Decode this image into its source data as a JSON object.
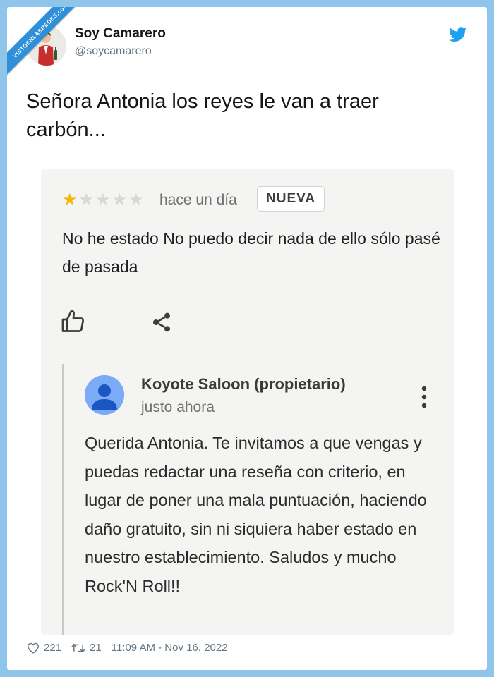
{
  "watermark": "VISTOENLASREDES.com",
  "user": {
    "name": "Soy Camarero",
    "handle": "@soycamarero"
  },
  "tweet": {
    "text": "Señora Antonia los reyes le van a traer carbón..."
  },
  "review": {
    "stars_filled": 1,
    "stars_total": 5,
    "time_ago": "hace un día",
    "badge": "NUEVA",
    "text": "No he estado No puedo decir nada de ello sólo pasé de pasada"
  },
  "owner_reply": {
    "name": "Koyote Saloon (propietario)",
    "time": "justo ahora",
    "text": "Querida Antonia. Te invitamos a que vengas y puedas redactar una reseña con criterio, en lugar de poner una mala puntuación, haciendo daño gratuito, sin ni siquiera haber estado en nuestro establecimiento. Saludos y mucho Rock'N Roll!!"
  },
  "footer": {
    "likes": "221",
    "retweets": "21",
    "timestamp": "11:09 AM - Nov 16, 2022"
  },
  "colors": {
    "background": "#8fc5ea",
    "twitter_blue": "#1da1f2",
    "star_filled": "#f5b70a",
    "star_empty": "#d8d8d8"
  },
  "icons": {
    "bird": "twitter-bird-icon",
    "like": "thumbs-up-icon",
    "share": "share-icon",
    "more": "kebab-menu-icon",
    "heart": "heart-icon",
    "retweet": "retweet-icon"
  }
}
